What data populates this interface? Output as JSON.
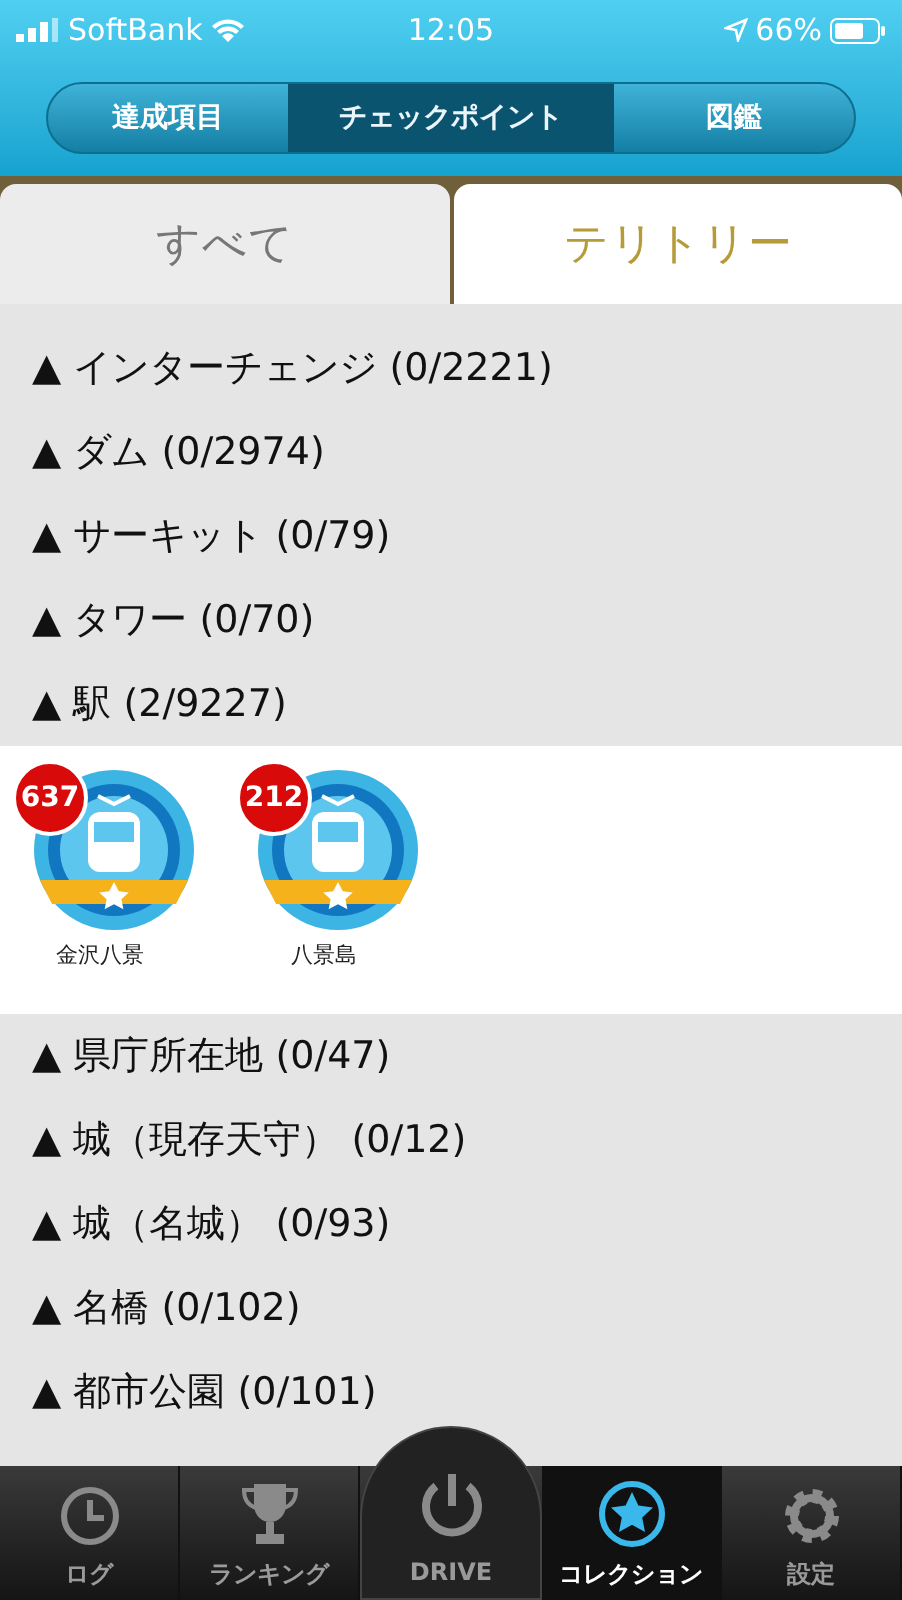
{
  "status_bar": {
    "carrier": "SoftBank",
    "time": "12:05",
    "battery": "66%"
  },
  "segments": [
    {
      "label": "達成項目",
      "selected": false
    },
    {
      "label": "チェックポイント",
      "selected": true
    },
    {
      "label": "図鑑",
      "selected": false
    }
  ],
  "tabs": [
    {
      "label": "すべて",
      "selected": false
    },
    {
      "label": "テリトリー",
      "selected": true
    }
  ],
  "list": [
    {
      "kind": "row",
      "text": "▲ インターチェンジ (0/2221)"
    },
    {
      "kind": "row",
      "text": "▲ ダム (0/2974)"
    },
    {
      "kind": "row",
      "text": "▲ サーキット (0/79)"
    },
    {
      "kind": "row",
      "text": "▲ タワー (0/70)"
    },
    {
      "kind": "row",
      "text": "▲ 駅 (2/9227)"
    },
    {
      "kind": "badges",
      "badges": [
        {
          "count": "637",
          "name": "金沢八景"
        },
        {
          "count": "212",
          "name": "八景島"
        }
      ]
    },
    {
      "kind": "row",
      "text": "▲ 県庁所在地 (0/47)"
    },
    {
      "kind": "row",
      "text": "▲ 城（現存天守） (0/12)"
    },
    {
      "kind": "row",
      "text": "▲ 城（名城） (0/93)"
    },
    {
      "kind": "row",
      "text": "▲ 名橋 (0/102)"
    },
    {
      "kind": "row",
      "text": "▲ 都市公園 (0/101)"
    }
  ],
  "tab_bar": [
    {
      "kind": "clock",
      "label": "ログ",
      "selected": false
    },
    {
      "kind": "trophy",
      "label": "ランキング",
      "selected": false
    },
    {
      "kind": "power",
      "label": "DRIVE",
      "selected": false
    },
    {
      "kind": "star",
      "label": "コレクション",
      "selected": true
    },
    {
      "kind": "gear",
      "label": "設定",
      "selected": false
    }
  ]
}
